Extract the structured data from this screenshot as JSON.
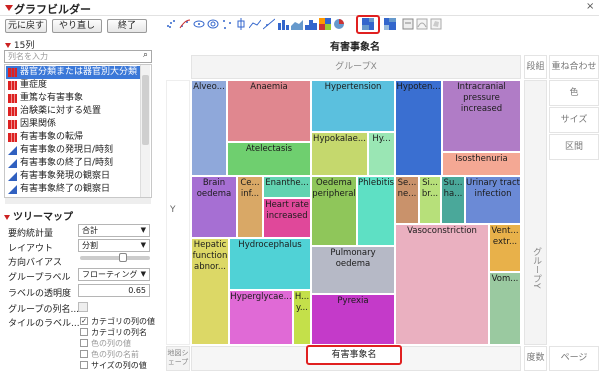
{
  "window": {
    "title": "グラフビルダー",
    "close": "×"
  },
  "buttons": {
    "undo": "元に戻す",
    "redo": "やり直し",
    "end": "終了"
  },
  "columns": {
    "count_label": "15列",
    "search_placeholder": "列名を入力",
    "items": [
      {
        "label": "器官分類または器官別大分類",
        "type": "nominal",
        "selected": true
      },
      {
        "label": "重症度",
        "type": "nominal"
      },
      {
        "label": "重篤な有害事象",
        "type": "nominal"
      },
      {
        "label": "治験薬に対する処置",
        "type": "nominal"
      },
      {
        "label": "因果関係",
        "type": "nominal"
      },
      {
        "label": "有害事象の転帰",
        "type": "nominal"
      },
      {
        "label": "有害事象の発現日/時刻",
        "type": "continuous"
      },
      {
        "label": "有害事象の終了日/時刻",
        "type": "continuous"
      },
      {
        "label": "有害事象発現の観察日",
        "type": "continuous"
      },
      {
        "label": "有害事象終了の観察日",
        "type": "continuous"
      }
    ]
  },
  "treemap_panel": {
    "header": "ツリーマップ",
    "summary_stat": {
      "label": "要約統計量",
      "value": "合計"
    },
    "layout": {
      "label": "レイアウト",
      "value": "分割"
    },
    "direction_bias": {
      "label": "方向バイアス",
      "level": 0.63
    },
    "group_label": {
      "label": "グループラベル",
      "value": "フローティング"
    },
    "label_opacity": {
      "label": "ラベルの透明度",
      "value": "0.65"
    },
    "group_name": {
      "label": "グループの列名..."
    },
    "tile_label": {
      "label": "タイルのラベル...",
      "options": [
        {
          "label": "カテゴリの列の値",
          "checked": true,
          "enabled": true
        },
        {
          "label": "カテゴリの列名",
          "checked": false,
          "enabled": true
        },
        {
          "label": "色の列の値",
          "checked": false,
          "enabled": false
        },
        {
          "label": "色の列の名前",
          "checked": false,
          "enabled": false
        },
        {
          "label": "サイズの列の値",
          "checked": false,
          "enabled": true
        }
      ]
    }
  },
  "graph": {
    "title": "有害事象名",
    "group_x": "グループX",
    "y_label": "Y",
    "x_label": "有害事象名",
    "group_y": "グループY",
    "zones": {
      "wrap": "段組",
      "overlay": "重ね合わせ",
      "color": "色",
      "size": "サイズ",
      "interval": "区間",
      "freq": "度数",
      "page": "ページ",
      "map_shape": "地図シェープ"
    }
  },
  "tiles": [
    {
      "label": "Alveo...",
      "color": "#8fa8da"
    },
    {
      "label": "Anaemia",
      "color": "#e0878f"
    },
    {
      "label": "Atelectasis",
      "color": "#6fcf6f"
    },
    {
      "label": "Hypertension",
      "color": "#5bc0de"
    },
    {
      "label": "Hypokalae...",
      "color": "#c5d86d"
    },
    {
      "label": "Hy...",
      "color": "#9ae6b4"
    },
    {
      "label": "Hypoten...",
      "color": "#3a6fd1"
    },
    {
      "label": "Intracranial pressure increased",
      "color": "#b07cc6"
    },
    {
      "label": "Isosthenuria",
      "color": "#f4a894"
    },
    {
      "label": "Brain oedema",
      "color": "#a66fd3"
    },
    {
      "label": "Ce... inf...",
      "color": "#d9a866"
    },
    {
      "label": "Enanthe...",
      "color": "#62d3b1"
    },
    {
      "label": "Heart rate increased",
      "color": "#e0489a"
    },
    {
      "label": "Oedema peripheral",
      "color": "#8fc65a"
    },
    {
      "label": "Phlebitis",
      "color": "#5ee0c4"
    },
    {
      "label": "Se... ne...",
      "color": "#c9926b"
    },
    {
      "label": "Si... br...",
      "color": "#b7e07a"
    },
    {
      "label": "Su... ha...",
      "color": "#4aa89a"
    },
    {
      "label": "Urinary tract infection",
      "color": "#6b8ad6"
    },
    {
      "label": "Vasoconstriction",
      "color": "#eab0c0"
    },
    {
      "label": "Vent... extr...",
      "color": "#e8b14a"
    },
    {
      "label": "Hepatic function abnor...",
      "color": "#dcd866"
    },
    {
      "label": "Hydrocephalus",
      "color": "#50d2d6"
    },
    {
      "label": "Pulmonary oedema",
      "color": "#b6b9c6"
    },
    {
      "label": "Hyperglycae...",
      "color": "#e06ad6"
    },
    {
      "label": "H... y...",
      "color": "#c4e04a"
    },
    {
      "label": "Pyrexia",
      "color": "#c43ac9"
    },
    {
      "label": "Vom...",
      "color": "#9ac9a0"
    }
  ]
}
